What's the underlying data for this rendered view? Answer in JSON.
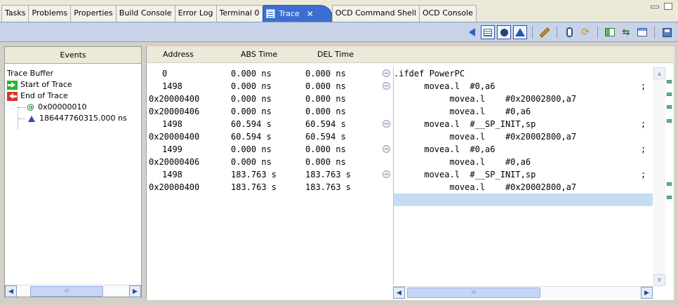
{
  "tabs": [
    {
      "label": "Tasks"
    },
    {
      "label": "Problems"
    },
    {
      "label": "Properties"
    },
    {
      "label": "Build Console"
    },
    {
      "label": "Error Log"
    },
    {
      "label": "Terminal 0"
    },
    {
      "label": "Trace",
      "active": true
    },
    {
      "label": "OCD Command Shell"
    },
    {
      "label": "OCD Console"
    }
  ],
  "active_tab_close": "✕",
  "toolbar": {
    "buttons": [
      "back-icon",
      "list-view-icon",
      "record-dot-icon",
      "triangle-filter-icon",
      "pencil-icon",
      "cylinder-icon",
      "refresh-cycle-icon",
      "split-view-icon",
      "arrows-icon",
      "window-icon",
      "save-icon"
    ]
  },
  "events": {
    "header": "Events",
    "root": "Trace Buffer",
    "start": "Start of Trace",
    "end": "End of Trace",
    "children": [
      "0x00000010",
      "186447760315.000 ns"
    ],
    "scroll_thumb": "III"
  },
  "table": {
    "headers": {
      "address": "Address",
      "abs": "ABS Time",
      "del": "DEL Time"
    },
    "rows": [
      {
        "address": "0",
        "abs": "0.000 ns",
        "del": "0.000 ns",
        "fold": true,
        "short": true
      },
      {
        "address": "1498",
        "abs": "0.000 ns",
        "del": "0.000 ns",
        "fold": true,
        "short": true
      },
      {
        "address": "0x20000400",
        "abs": "0.000 ns",
        "del": "0.000 ns",
        "fold": false
      },
      {
        "address": "0x20000406",
        "abs": "0.000 ns",
        "del": "0.000 ns",
        "fold": false
      },
      {
        "address": "1498",
        "abs": "60.594 s",
        "del": "60.594 s",
        "fold": true,
        "short": true
      },
      {
        "address": "0x20000400",
        "abs": "60.594 s",
        "del": "60.594 s",
        "fold": false
      },
      {
        "address": "1499",
        "abs": "0.000 ns",
        "del": "0.000 ns",
        "fold": true,
        "short": true
      },
      {
        "address": "0x20000406",
        "abs": "0.000 ns",
        "del": "0.000 ns",
        "fold": false
      },
      {
        "address": "1498",
        "abs": "183.763 s",
        "del": "183.763 s",
        "fold": true,
        "short": true
      },
      {
        "address": "0x20000400",
        "abs": "183.763 s",
        "del": "183.763 s",
        "fold": false
      }
    ]
  },
  "source": {
    "lines": [
      {
        "text": ".ifdef PowerPC",
        "semi": ""
      },
      {
        "text": "      movea.l  #0,a6",
        "semi": ";"
      },
      {
        "text": "           movea.l    #0x20002800,a7",
        "semi": ""
      },
      {
        "text": "           movea.l    #0,a6",
        "semi": ""
      },
      {
        "text": "      movea.l  #__SP_INIT,sp",
        "semi": ";"
      },
      {
        "text": "           movea.l    #0x20002800,a7",
        "semi": ""
      },
      {
        "text": "      movea.l  #0,a6",
        "semi": ";"
      },
      {
        "text": "           movea.l    #0,a6",
        "semi": ""
      },
      {
        "text": "      movea.l  #__SP_INIT,sp",
        "semi": ";"
      },
      {
        "text": "           movea.l    #0x20002800,a7",
        "semi": ""
      },
      {
        "text": "",
        "semi": "",
        "selected": true
      }
    ],
    "scroll_thumb": "III"
  },
  "colors": {
    "active_tab": "#3a6fd1",
    "toolbar": "#c8d3e8",
    "selection": "#c5dcf4"
  }
}
